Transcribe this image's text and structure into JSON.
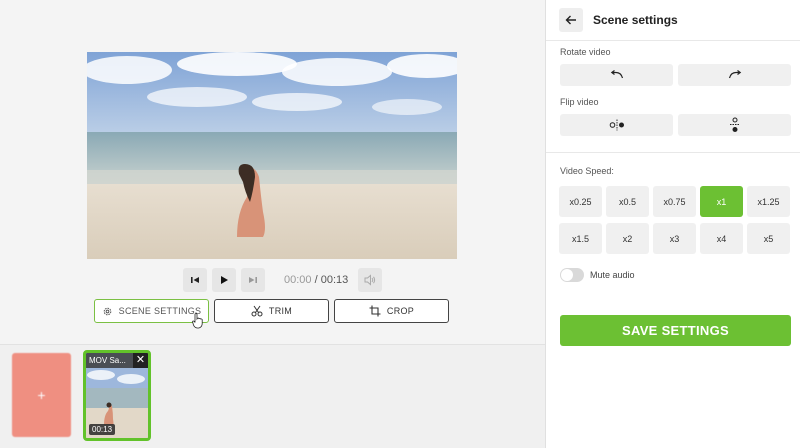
{
  "player": {
    "time_current": "00:00",
    "time_separator": " / ",
    "time_total": "00:13",
    "prev_icon": "skip-back-icon",
    "play_icon": "play-icon",
    "next_icon": "skip-forward-icon",
    "volume_icon": "speaker-icon"
  },
  "tools": {
    "scene_settings_label": "SCENE SETTINGS",
    "trim_label": "TRIM",
    "crop_label": "CROP"
  },
  "timeline": {
    "add_label": "+",
    "clip_name": "MOV Sa...",
    "clip_close": "✕",
    "clip_duration": "00:13"
  },
  "panel": {
    "title": "Scene settings",
    "rotate_label": "Rotate video",
    "flip_label": "Flip video",
    "speed_label": "Video Speed:",
    "speeds": [
      "x0.25",
      "x0.5",
      "x0.75",
      "x1",
      "x1.25",
      "x1.5",
      "x2",
      "x3",
      "x4",
      "x5"
    ],
    "selected_speed": "x1",
    "mute_label": "Mute audio",
    "mute_on": false,
    "save_label": "SAVE SETTINGS"
  },
  "colors": {
    "accent": "#6cc033",
    "clip_border": "#62c22a",
    "add_tile": "#ef8a7c"
  }
}
